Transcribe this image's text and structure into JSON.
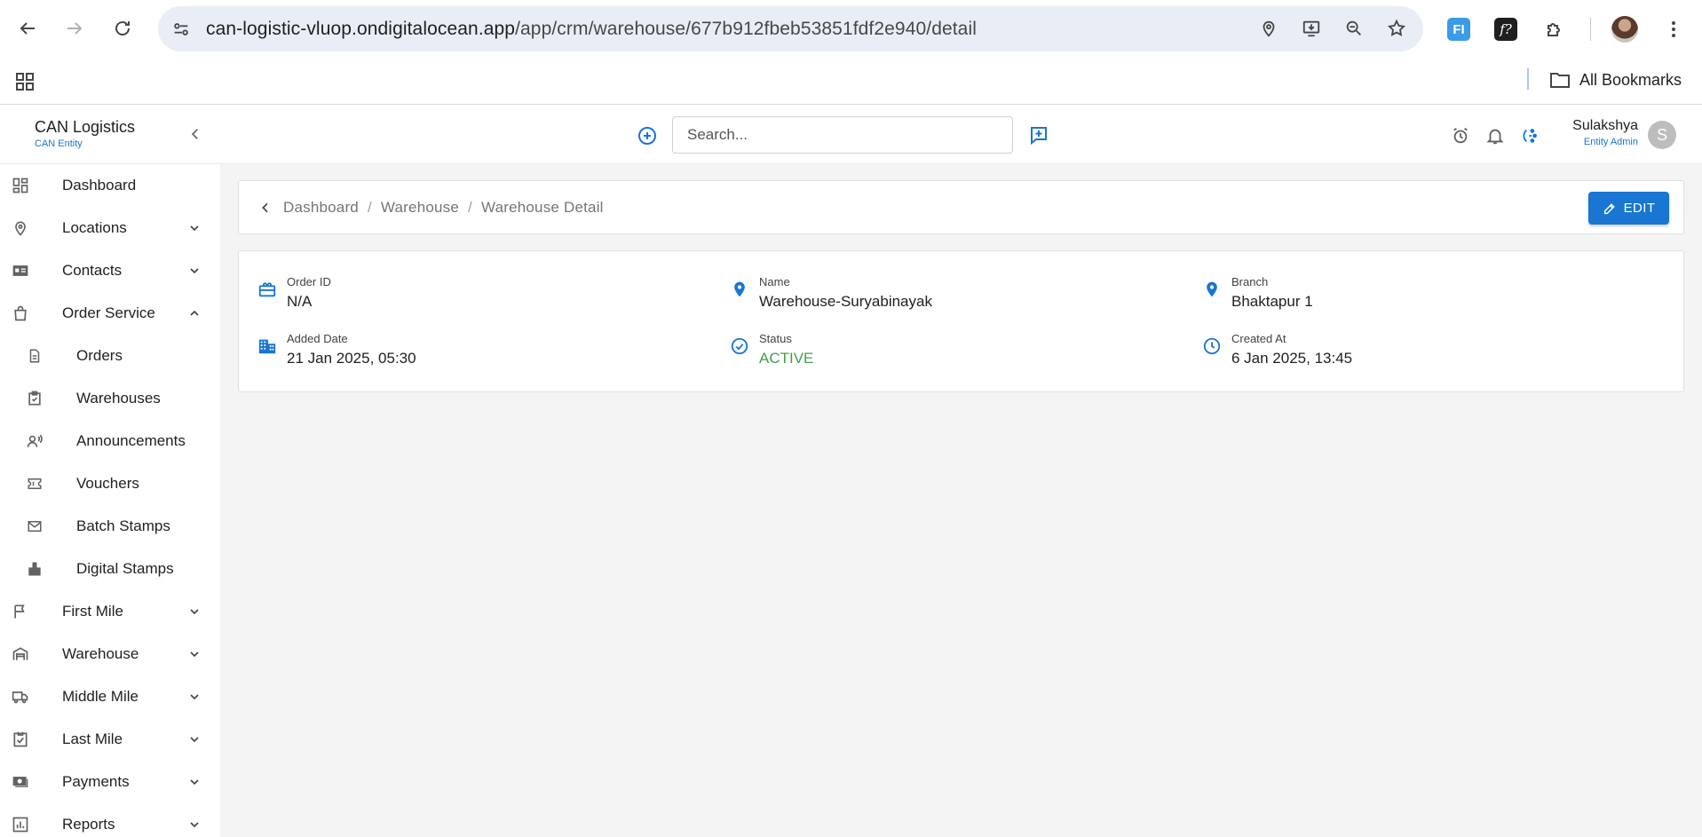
{
  "browser": {
    "url_host": "can-logistic-vluop.ondigitalocean.app",
    "url_path": "/app/crm/warehouse/677b912fbeb53851fdf2e940/detail",
    "bookmarks_label": "All Bookmarks",
    "ext_fi": "FI",
    "ext_fx": "f?"
  },
  "header": {
    "brand_title": "CAN Logistics",
    "brand_sub": "CAN Entity",
    "search_placeholder": "Search...",
    "user_name": "Sulakshya",
    "user_role": "Entity Admin",
    "avatar_initial": "S"
  },
  "sidebar": {
    "items": [
      {
        "label": "Dashboard",
        "icon": "dashboard-icon"
      },
      {
        "label": "Locations",
        "icon": "location-pin-icon"
      },
      {
        "label": "Contacts",
        "icon": "contact-card-icon"
      },
      {
        "label": "Order Service",
        "icon": "shopping-bag-icon"
      },
      {
        "label": "Orders",
        "icon": "document-icon"
      },
      {
        "label": "Warehouses",
        "icon": "warehouse-clipboard-icon"
      },
      {
        "label": "Announcements",
        "icon": "announcement-icon"
      },
      {
        "label": "Vouchers",
        "icon": "voucher-icon"
      },
      {
        "label": "Batch Stamps",
        "icon": "mail-icon"
      },
      {
        "label": "Digital Stamps",
        "icon": "stamp-icon"
      },
      {
        "label": "First Mile",
        "icon": "flag-icon"
      },
      {
        "label": "Warehouse",
        "icon": "warehouse-icon"
      },
      {
        "label": "Middle Mile",
        "icon": "truck-icon"
      },
      {
        "label": "Last Mile",
        "icon": "checklist-icon"
      },
      {
        "label": "Payments",
        "icon": "payments-icon"
      },
      {
        "label": "Reports",
        "icon": "reports-icon"
      }
    ]
  },
  "breadcrumb": {
    "items": [
      "Dashboard",
      "Warehouse",
      "Warehouse Detail"
    ],
    "separator": "/"
  },
  "edit_label": "EDIT",
  "details": {
    "order_id": {
      "label": "Order ID",
      "value": "N/A"
    },
    "name": {
      "label": "Name",
      "value": "Warehouse-Suryabinayak"
    },
    "branch": {
      "label": "Branch",
      "value": "Bhaktapur 1"
    },
    "added_date": {
      "label": "Added Date",
      "value": "21 Jan 2025, 05:30"
    },
    "status": {
      "label": "Status",
      "value": "ACTIVE"
    },
    "created_at": {
      "label": "Created At",
      "value": "6 Jan 2025, 13:45"
    }
  },
  "colors": {
    "accent": "#1976d2",
    "status_active": "#43a047",
    "main_bg": "#f4f4f4"
  }
}
